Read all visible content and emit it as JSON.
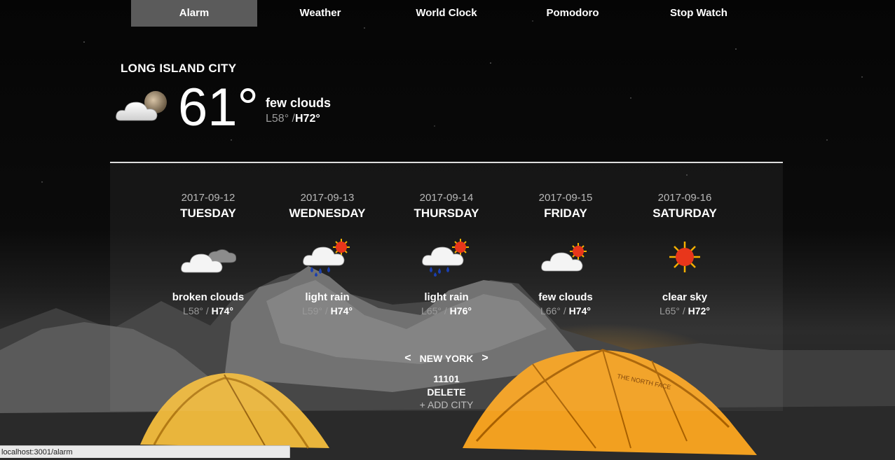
{
  "nav": {
    "items": [
      {
        "label": "Alarm",
        "active": true
      },
      {
        "label": "Weather",
        "active": false
      },
      {
        "label": "World Clock",
        "active": false
      },
      {
        "label": "Pomodoro",
        "active": false
      },
      {
        "label": "Stop Watch",
        "active": false
      }
    ]
  },
  "current": {
    "city": "LONG ISLAND CITY",
    "icon": "cloud-moon-icon",
    "temp": "61°",
    "description": "few clouds",
    "low": "L58°",
    "separator": "/",
    "high": "H72°"
  },
  "forecast": [
    {
      "date": "2017-09-12",
      "day": "TUESDAY",
      "icon": "broken-clouds-icon",
      "description": "broken clouds",
      "low": "L58°",
      "separator": "/",
      "high": "H74°"
    },
    {
      "date": "2017-09-13",
      "day": "WEDNESDAY",
      "icon": "light-rain-icon",
      "description": "light rain",
      "low": "L59°",
      "separator": "/",
      "high": "H74°"
    },
    {
      "date": "2017-09-14",
      "day": "THURSDAY",
      "icon": "light-rain-icon",
      "description": "light rain",
      "low": "L65°",
      "separator": "/",
      "high": "H76°"
    },
    {
      "date": "2017-09-15",
      "day": "FRIDAY",
      "icon": "few-clouds-icon",
      "description": "few clouds",
      "low": "L66°",
      "separator": "/",
      "high": "H74°"
    },
    {
      "date": "2017-09-16",
      "day": "SATURDAY",
      "icon": "sun-icon",
      "description": "clear sky",
      "low": "L65°",
      "separator": "/",
      "high": "H72°"
    }
  ],
  "switcher": {
    "prev": "<",
    "city": "NEW YORK",
    "next": ">",
    "zip": "11101",
    "delete_label": "DELETE",
    "add_label": "+ ADD CITY"
  },
  "statusbar": {
    "url": "localhost:3001/alarm"
  },
  "colors": {
    "nav_active_bg": "#787878",
    "low_text": "#9a9a9a",
    "sun": "#e8361b",
    "rain": "#1a3fb0"
  }
}
